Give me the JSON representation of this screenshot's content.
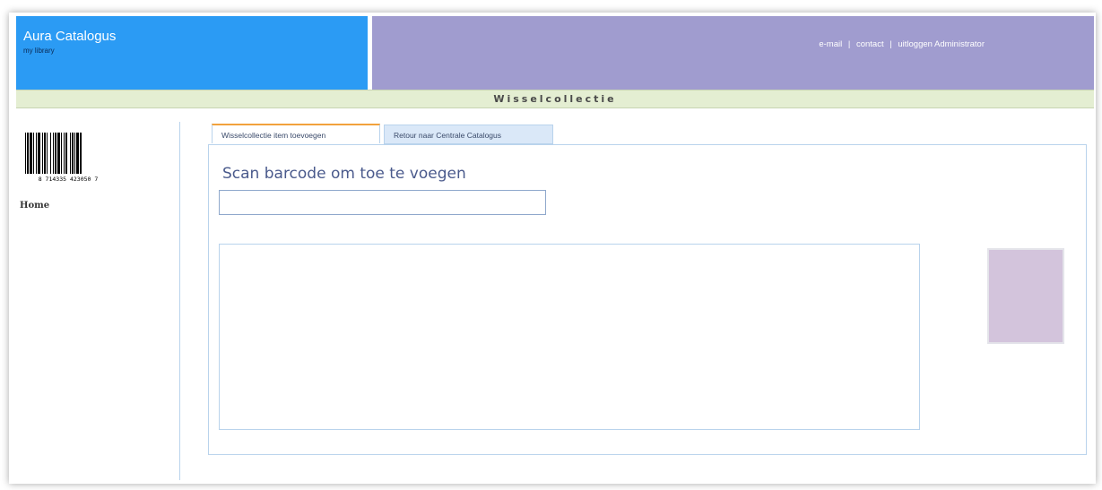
{
  "header": {
    "brand_title": "Aura Catalogus",
    "brand_subtitle": "my library",
    "links": {
      "email": "e-mail",
      "separator": "|",
      "contact": "contact",
      "logout": "uitloggen Administrator"
    }
  },
  "page_title": "Wisselcollectie",
  "sidebar": {
    "barcode_number": "8 714335 423050 7",
    "home_label": "Home"
  },
  "tabs": [
    {
      "label": "Wisselcollectie item toevoegen",
      "active": true
    },
    {
      "label": "Retour naar Centrale Catalogus",
      "active": false
    }
  ],
  "main": {
    "scan_heading": "Scan barcode om toe te voegen",
    "scan_input_value": "",
    "scan_input_placeholder": ""
  },
  "colors": {
    "header_blue": "#2b9bf4",
    "header_purple": "#a09ccf",
    "title_bar_green": "#e4eed2",
    "active_tab_accent": "#f2a23c",
    "item_image_placeholder": "#d3c4dc"
  }
}
